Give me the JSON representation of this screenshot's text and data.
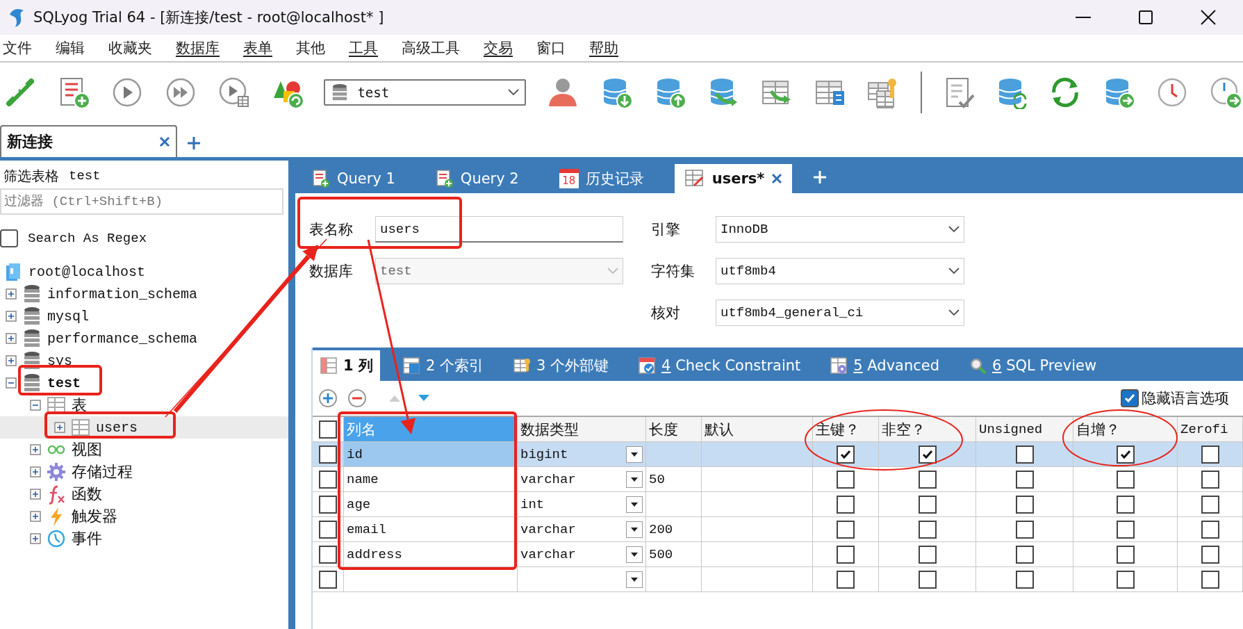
{
  "window": {
    "title": "SQLyog Trial 64 - [新连接/test - root@localhost* ]"
  },
  "menu": [
    {
      "label": "文件",
      "underlined": false
    },
    {
      "label": "编辑",
      "underlined": false
    },
    {
      "label": "收藏夹",
      "underlined": false
    },
    {
      "label": "数据库",
      "underlined": true
    },
    {
      "label": "表单",
      "underlined": true
    },
    {
      "label": "其他",
      "underlined": false
    },
    {
      "label": "工具",
      "underlined": true
    },
    {
      "label": "高级工具",
      "underlined": false
    },
    {
      "label": "交易",
      "underlined": true
    },
    {
      "label": "窗口",
      "underlined": false
    },
    {
      "label": "帮助",
      "underlined": true
    }
  ],
  "toolbar": {
    "database": "test"
  },
  "connection_tabs": [
    {
      "label": "新连接",
      "selected": true
    }
  ],
  "sidebar": {
    "filter_label": "筛选表格",
    "filter_value": "test",
    "filter_placeholder": "过滤器 (Ctrl+Shift+B)",
    "regex": {
      "label": "Search As Regex",
      "checked": false
    },
    "tree": [
      {
        "label": "root@localhost",
        "kind": "server",
        "selected": false,
        "children": [
          {
            "label": "information_schema",
            "kind": "database",
            "expanded": false,
            "selected": false
          },
          {
            "label": "mysql",
            "kind": "database",
            "expanded": false,
            "selected": false
          },
          {
            "label": "performance_schema",
            "kind": "database",
            "expanded": false,
            "selected": false
          },
          {
            "label": "sys",
            "kind": "database",
            "expanded": false,
            "selected": false
          },
          {
            "label": "test",
            "kind": "database",
            "expanded": true,
            "selected": false,
            "current": true,
            "children": [
              {
                "label": "表",
                "kind": "tables",
                "expanded": true,
                "selected": false,
                "children": [
                  {
                    "label": "users",
                    "kind": "table",
                    "expanded": false,
                    "selected": true
                  }
                ]
              },
              {
                "label": "视图",
                "kind": "views",
                "expanded": false,
                "selected": false
              },
              {
                "label": "存储过程",
                "kind": "procedures",
                "expanded": false,
                "selected": false
              },
              {
                "label": "函数",
                "kind": "functions",
                "expanded": false,
                "selected": false
              },
              {
                "label": "触发器",
                "kind": "triggers",
                "expanded": false,
                "selected": false
              },
              {
                "label": "事件",
                "kind": "events",
                "expanded": false,
                "selected": false
              }
            ]
          }
        ]
      }
    ]
  },
  "editor_tabs": [
    {
      "label": "Query 1",
      "kind": "query",
      "selected": false,
      "closable": false
    },
    {
      "label": "Query 2",
      "kind": "query",
      "selected": false,
      "closable": false
    },
    {
      "label": "历史记录",
      "kind": "history",
      "icon_text": "18",
      "selected": false,
      "closable": false
    },
    {
      "label": "users*",
      "kind": "table",
      "selected": true,
      "closable": true
    }
  ],
  "form": {
    "table_name": {
      "label": "表名称",
      "value": "users"
    },
    "database": {
      "label": "数据库",
      "value": "test",
      "disabled": true
    },
    "engine": {
      "label": "引擎",
      "value": "InnoDB"
    },
    "charset": {
      "label": "字符集",
      "value": "utf8mb4"
    },
    "collation": {
      "label": "核对",
      "value": "utf8mb4_general_ci"
    }
  },
  "column_tabs": [
    {
      "key": "1",
      "label": "列",
      "kind": "columns",
      "underlined": false,
      "selected": true
    },
    {
      "key": "2",
      "label": "个索引",
      "kind": "indexes",
      "underlined": false,
      "selected": false
    },
    {
      "key": "3",
      "label": "个外部键",
      "kind": "foreign",
      "underlined": false,
      "selected": false
    },
    {
      "key": "4",
      "label": "Check Constraint",
      "kind": "check",
      "underlined": true,
      "selected": false
    },
    {
      "key": "5",
      "label": "Advanced",
      "kind": "advanced",
      "underlined": true,
      "selected": false
    },
    {
      "key": "6",
      "label": "SQL Preview",
      "kind": "preview",
      "underlined": true,
      "selected": false
    }
  ],
  "hide_language_options": {
    "label": "隐藏语言选项",
    "checked": true
  },
  "grid": {
    "all_checked": false,
    "columns": [
      {
        "label": "列名",
        "selected": true
      },
      {
        "label": "数据类型",
        "selected": false
      },
      {
        "label": "长度",
        "selected": false
      },
      {
        "label": "默认",
        "selected": false
      },
      {
        "label": "主键？",
        "selected": false
      },
      {
        "label": "非空？",
        "selected": false
      },
      {
        "label": "Unsigned",
        "selected": false
      },
      {
        "label": "自增？",
        "selected": false
      },
      {
        "label": "Zerofi",
        "selected": false
      }
    ],
    "rows": [
      {
        "name": "id",
        "type": "bigint",
        "selected": true,
        "checked": false,
        "flags": [
          true,
          true,
          false,
          true,
          false
        ]
      },
      {
        "name": "name",
        "type": "varchar",
        "length": "50",
        "selected": false,
        "checked": false,
        "flags": [
          false,
          false,
          false,
          false,
          false
        ]
      },
      {
        "name": "age",
        "type": "int",
        "selected": false,
        "checked": false,
        "flags": [
          false,
          false,
          false,
          false,
          false
        ]
      },
      {
        "name": "email",
        "type": "varchar",
        "length": "200",
        "selected": false,
        "checked": false,
        "flags": [
          false,
          false,
          false,
          false,
          false
        ]
      },
      {
        "name": "address",
        "type": "varchar",
        "length": "500",
        "selected": false,
        "checked": false,
        "flags": [
          false,
          false,
          false,
          false,
          false
        ]
      },
      {
        "selected": false,
        "checked": false,
        "flags": [
          false,
          false,
          false,
          false,
          false
        ]
      }
    ]
  }
}
